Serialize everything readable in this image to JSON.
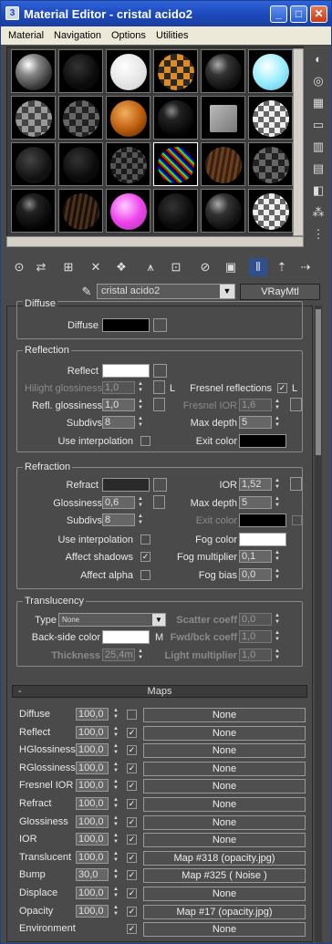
{
  "window": {
    "title": "Material Editor - cristal acido2",
    "app_icon": "3"
  },
  "menu": [
    "Material",
    "Navigation",
    "Options",
    "Utilities"
  ],
  "material_name": "cristal acido2",
  "material_type": "VRayMtl",
  "diffuse_group": {
    "title": "Diffuse",
    "diffuse_label": "Diffuse",
    "diffuse_color": "#000000"
  },
  "reflection": {
    "title": "Reflection",
    "reflect_label": "Reflect",
    "reflect_color": "#ffffff",
    "hilight_label": "Hilight glossiness",
    "hilight_value": "1,0",
    "l_label": "L",
    "fresnel_label": "Fresnel reflections",
    "fresnel_l": "L",
    "refl_gloss_label": "Refl. glossiness",
    "refl_gloss_value": "1,0",
    "fresnel_ior_label": "Fresnel IOR",
    "fresnel_ior_value": "1,6",
    "subdivs_label": "Subdivs",
    "subdivs_value": "8",
    "maxdepth_label": "Max depth",
    "maxdepth_value": "5",
    "interp_label": "Use interpolation",
    "exit_label": "Exit color",
    "exit_color": "#000000"
  },
  "refraction": {
    "title": "Refraction",
    "refract_label": "Refract",
    "refract_color": "#2a2a2a",
    "ior_label": "IOR",
    "ior_value": "1,52",
    "gloss_label": "Glossiness",
    "gloss_value": "0,6",
    "maxdepth_label": "Max depth",
    "maxdepth_value": "5",
    "subdivs_label": "Subdivs",
    "subdivs_value": "8",
    "exit_label": "Exit color",
    "exit_color": "#000000",
    "interp_label": "Use interpolation",
    "fog_color_label": "Fog color",
    "fog_color": "#ffffff",
    "shadows_label": "Affect shadows",
    "fog_mult_label": "Fog multiplier",
    "fog_mult_value": "0,1",
    "alpha_label": "Affect alpha",
    "fog_bias_label": "Fog bias",
    "fog_bias_value": "0,0"
  },
  "translucency": {
    "title": "Translucency",
    "type_label": "Type",
    "type_value": "None",
    "scatter_label": "Scatter coeff",
    "scatter_value": "0,0",
    "backside_label": "Back-side color",
    "backside_color": "#ffffff",
    "m_label": "M",
    "fwd_label": "Fwd/bck coeff",
    "fwd_value": "1,0",
    "thickness_label": "Thickness",
    "thickness_value": "25,4m",
    "light_label": "Light multiplier",
    "light_value": "1,0"
  },
  "maps": {
    "title": "Maps",
    "collapse": "-",
    "rows": [
      {
        "label": "Diffuse",
        "amount": "100,0",
        "enabled": false,
        "map": "None"
      },
      {
        "label": "Reflect",
        "amount": "100,0",
        "enabled": true,
        "map": "None"
      },
      {
        "label": "HGlossiness",
        "amount": "100,0",
        "enabled": true,
        "map": "None"
      },
      {
        "label": "RGlossiness",
        "amount": "100,0",
        "enabled": true,
        "map": "None"
      },
      {
        "label": "Fresnel IOR",
        "amount": "100,0",
        "enabled": true,
        "map": "None"
      },
      {
        "label": "Refract",
        "amount": "100,0",
        "enabled": true,
        "map": "None"
      },
      {
        "label": "Glossiness",
        "amount": "100,0",
        "enabled": true,
        "map": "None"
      },
      {
        "label": "IOR",
        "amount": "100,0",
        "enabled": true,
        "map": "None"
      },
      {
        "label": "Translucent",
        "amount": "100,0",
        "enabled": true,
        "map": "Map #318 (opacity.jpg)"
      },
      {
        "label": "Bump",
        "amount": "30,0",
        "enabled": true,
        "map": "Map #325  ( Noise )"
      },
      {
        "label": "Displace",
        "amount": "100,0",
        "enabled": true,
        "map": "None"
      },
      {
        "label": "Opacity",
        "amount": "100,0",
        "enabled": true,
        "map": "Map #17 (opacity.jpg)"
      },
      {
        "label": "Environment",
        "amount": "",
        "enabled": true,
        "map": "None"
      }
    ]
  },
  "sample_slots": [
    "gray-glossy",
    "black",
    "white",
    "orange-checker",
    "dark-glossy",
    "light-blue",
    "gray-checker",
    "dark-checker",
    "orange",
    "black-glossy",
    "gray-box",
    "checker",
    "black-dots",
    "black",
    "dark-checker2",
    "rainbow-noise",
    "wood",
    "dark-checker",
    "black-glossy",
    "wood-dark",
    "pink",
    "black",
    "dark-glossy",
    "checker"
  ],
  "icons": {
    "minimize": "_",
    "maximize": "□",
    "close": "✕",
    "checkmark": "✓"
  }
}
